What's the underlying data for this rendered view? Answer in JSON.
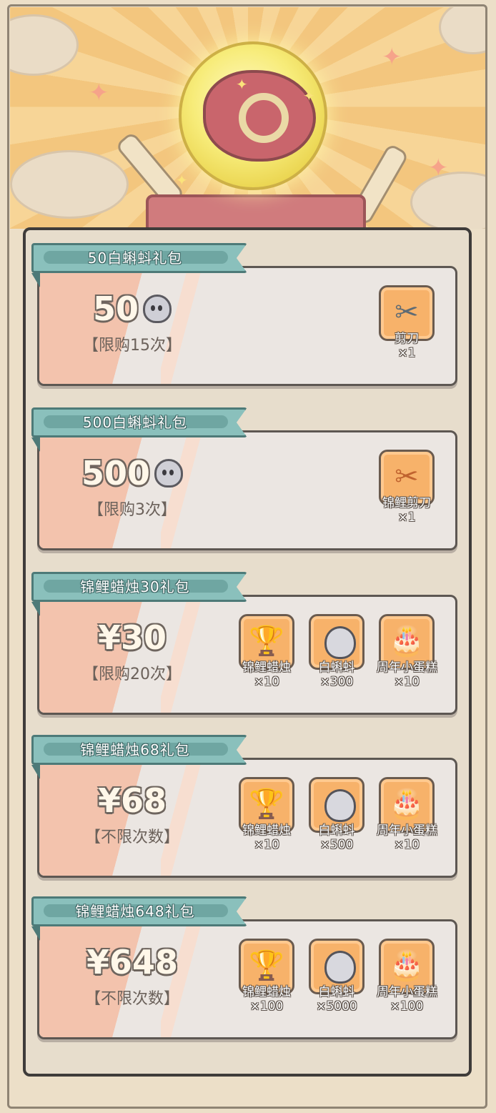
{
  "packs": [
    {
      "title": "50白蝌蚪礼包",
      "price": "50",
      "price_currency": "tadpole",
      "limit": "【限购15次】",
      "items": [
        {
          "icon": "scissors-icon",
          "name": "剪刀",
          "qty": "×1"
        }
      ]
    },
    {
      "title": "500白蝌蚪礼包",
      "price": "500",
      "price_currency": "tadpole",
      "limit": "【限购3次】",
      "items": [
        {
          "icon": "koi-scissors-icon",
          "name": "锦鲤剪刀",
          "qty": "×1"
        }
      ]
    },
    {
      "title": "锦鲤蜡烛30礼包",
      "price": "¥30",
      "limit": "【限购20次】",
      "items": [
        {
          "icon": "koi-candle-icon",
          "name": "锦鲤蜡烛",
          "qty": "×10"
        },
        {
          "icon": "white-tadpole-icon",
          "name": "白蝌蚪",
          "qty": "×300"
        },
        {
          "icon": "anniversary-cake-icon",
          "name": "周年小蛋糕",
          "qty": "×10"
        }
      ]
    },
    {
      "title": "锦鲤蜡烛68礼包",
      "price": "¥68",
      "limit": "【不限次数】",
      "items": [
        {
          "icon": "koi-candle-icon",
          "name": "锦鲤蜡烛",
          "qty": "×10"
        },
        {
          "icon": "white-tadpole-icon",
          "name": "白蝌蚪",
          "qty": "×500"
        },
        {
          "icon": "anniversary-cake-icon",
          "name": "周年小蛋糕",
          "qty": "×10"
        }
      ]
    },
    {
      "title": "锦鲤蜡烛648礼包",
      "price": "¥648",
      "limit": "【不限次数】",
      "items": [
        {
          "icon": "koi-candle-icon",
          "name": "锦鲤蜡烛",
          "qty": "×100"
        },
        {
          "icon": "white-tadpole-icon",
          "name": "白蝌蚪",
          "qty": "×5000"
        },
        {
          "icon": "anniversary-cake-icon",
          "name": "周年小蛋糕",
          "qty": "×100"
        }
      ]
    }
  ],
  "colors": {
    "ribbon": "#8ac0bc",
    "card_stripe": "#f3c3ad",
    "item_tile": "#f7b26a",
    "banner_rays": "#f3c67e"
  }
}
